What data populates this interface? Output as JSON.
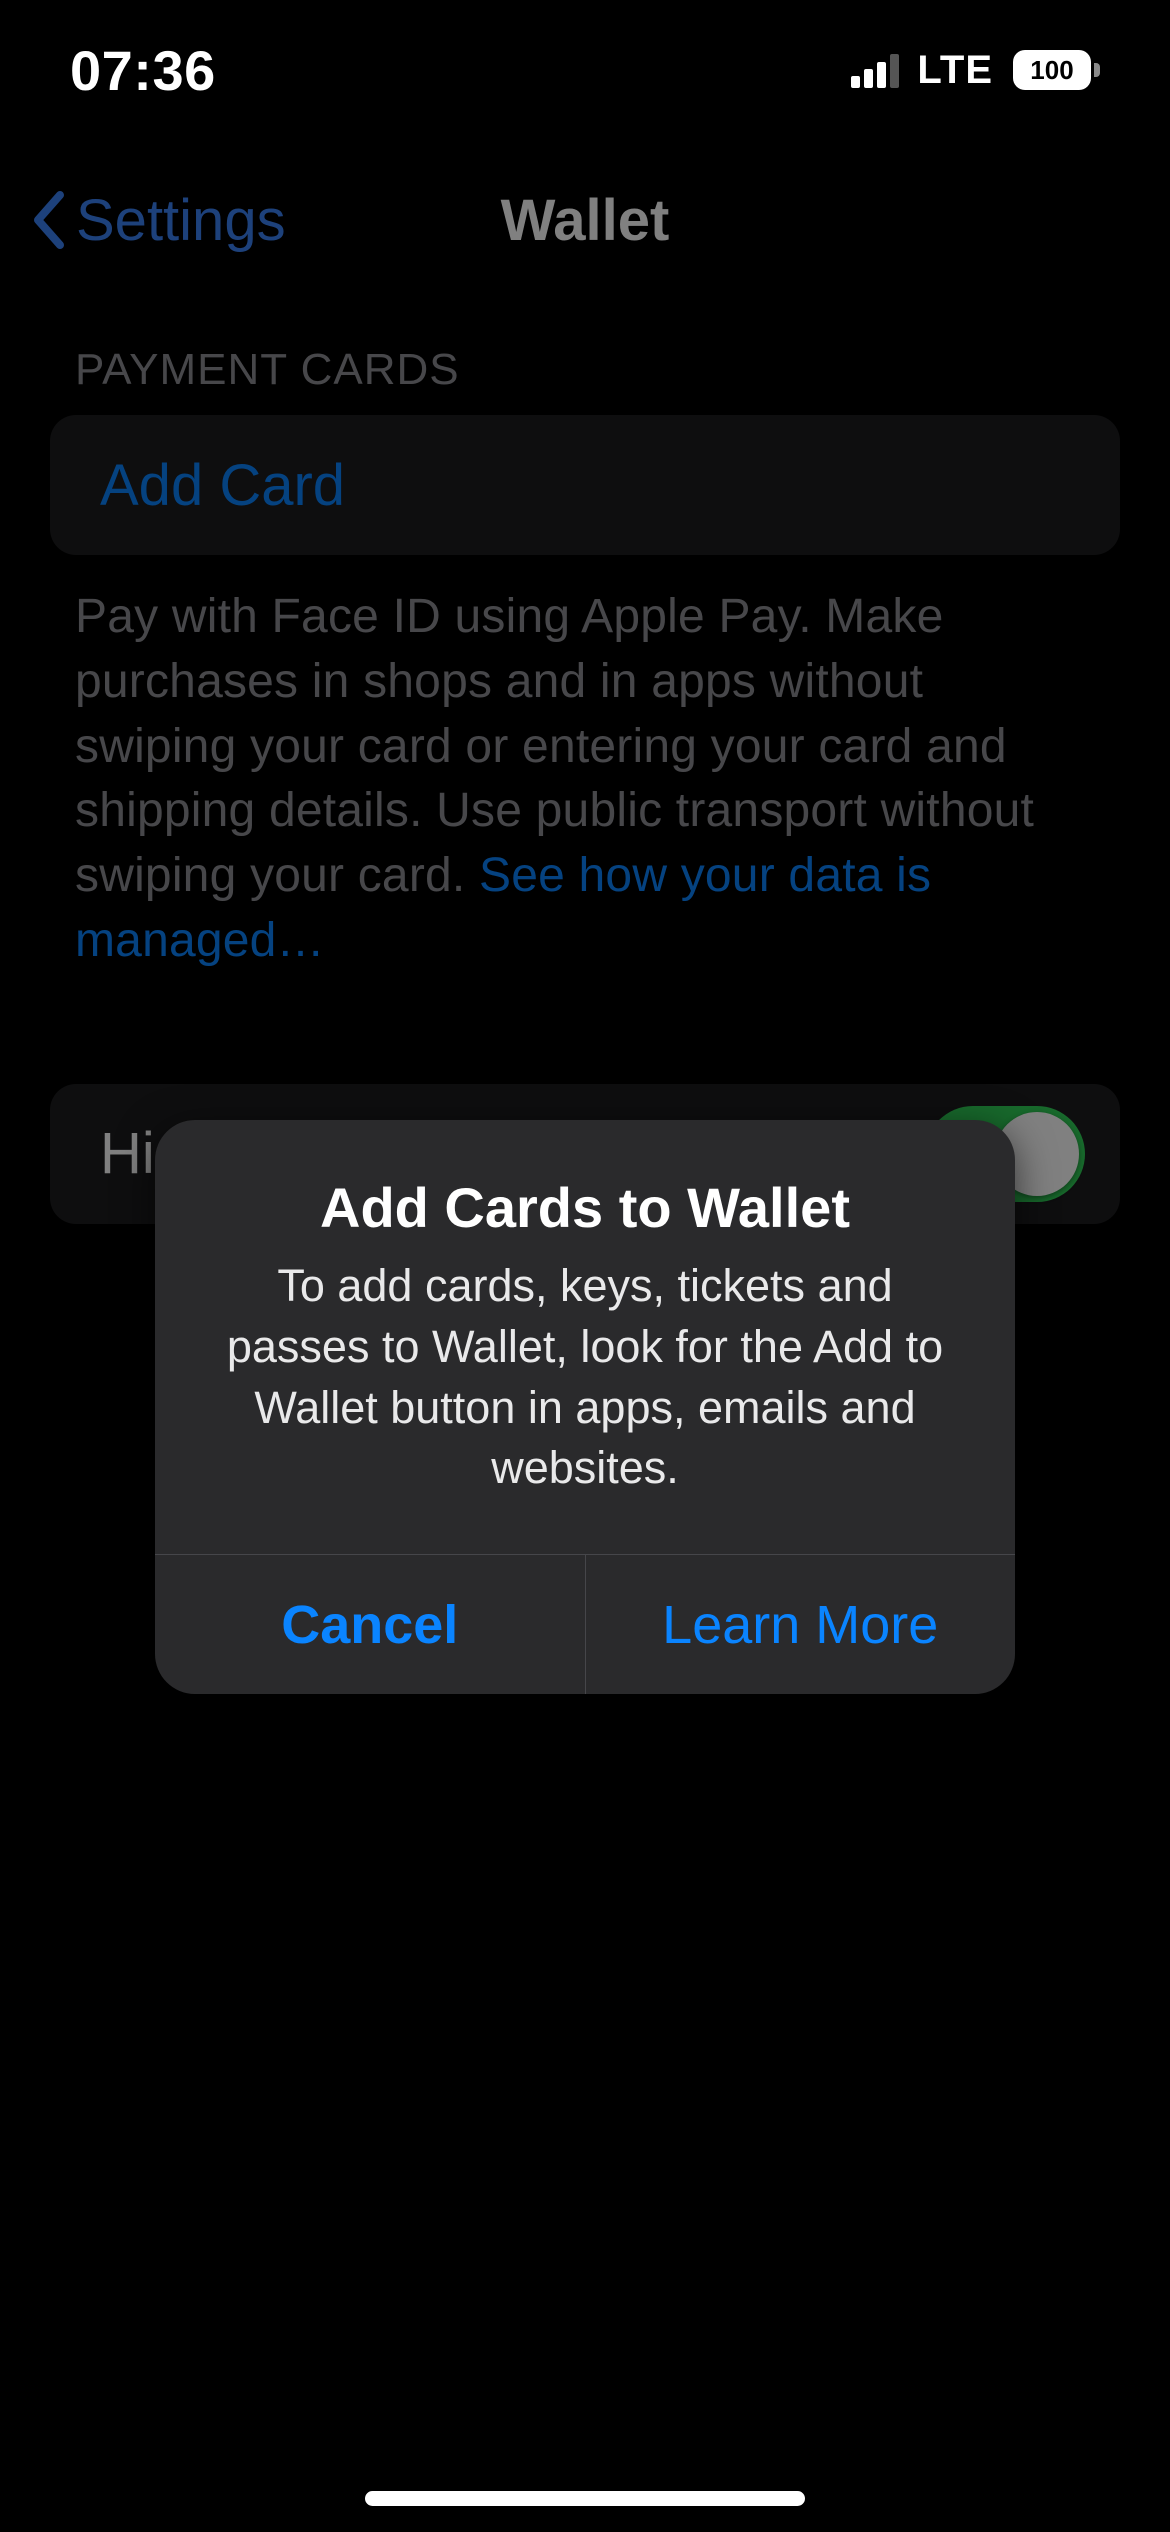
{
  "status": {
    "time": "07:36",
    "network": "LTE",
    "battery": "100"
  },
  "nav": {
    "back_label": "Settings",
    "title": "Wallet"
  },
  "payment": {
    "header": "PAYMENT CARDS",
    "add_card": "Add Card",
    "footer_text": "Pay with Face ID using Apple Pay. Make purchases in shops and in apps without swiping your card or entering your card and shipping details. Use public transport without swiping your card. ",
    "footer_link": "See how your data is managed…"
  },
  "toggle": {
    "label": "Hide Expired Passes",
    "value": true
  },
  "alert": {
    "title": "Add Cards to Wallet",
    "message": "To add cards, keys, tickets and passes to Wallet, look for the Add to Wallet button in apps, emails and websites.",
    "cancel": "Cancel",
    "learn_more": "Learn More"
  }
}
